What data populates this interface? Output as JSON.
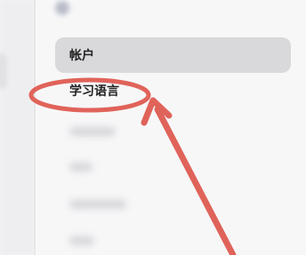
{
  "sidebar": {
    "items": [
      {
        "label": "帐户",
        "selected": true
      },
      {
        "label": "学习语言",
        "highlighted": true
      }
    ]
  },
  "colors": {
    "annotation": "#e0635a",
    "selected_bg": "#d9d9dc",
    "panel_bg": "#f7f7f8"
  }
}
